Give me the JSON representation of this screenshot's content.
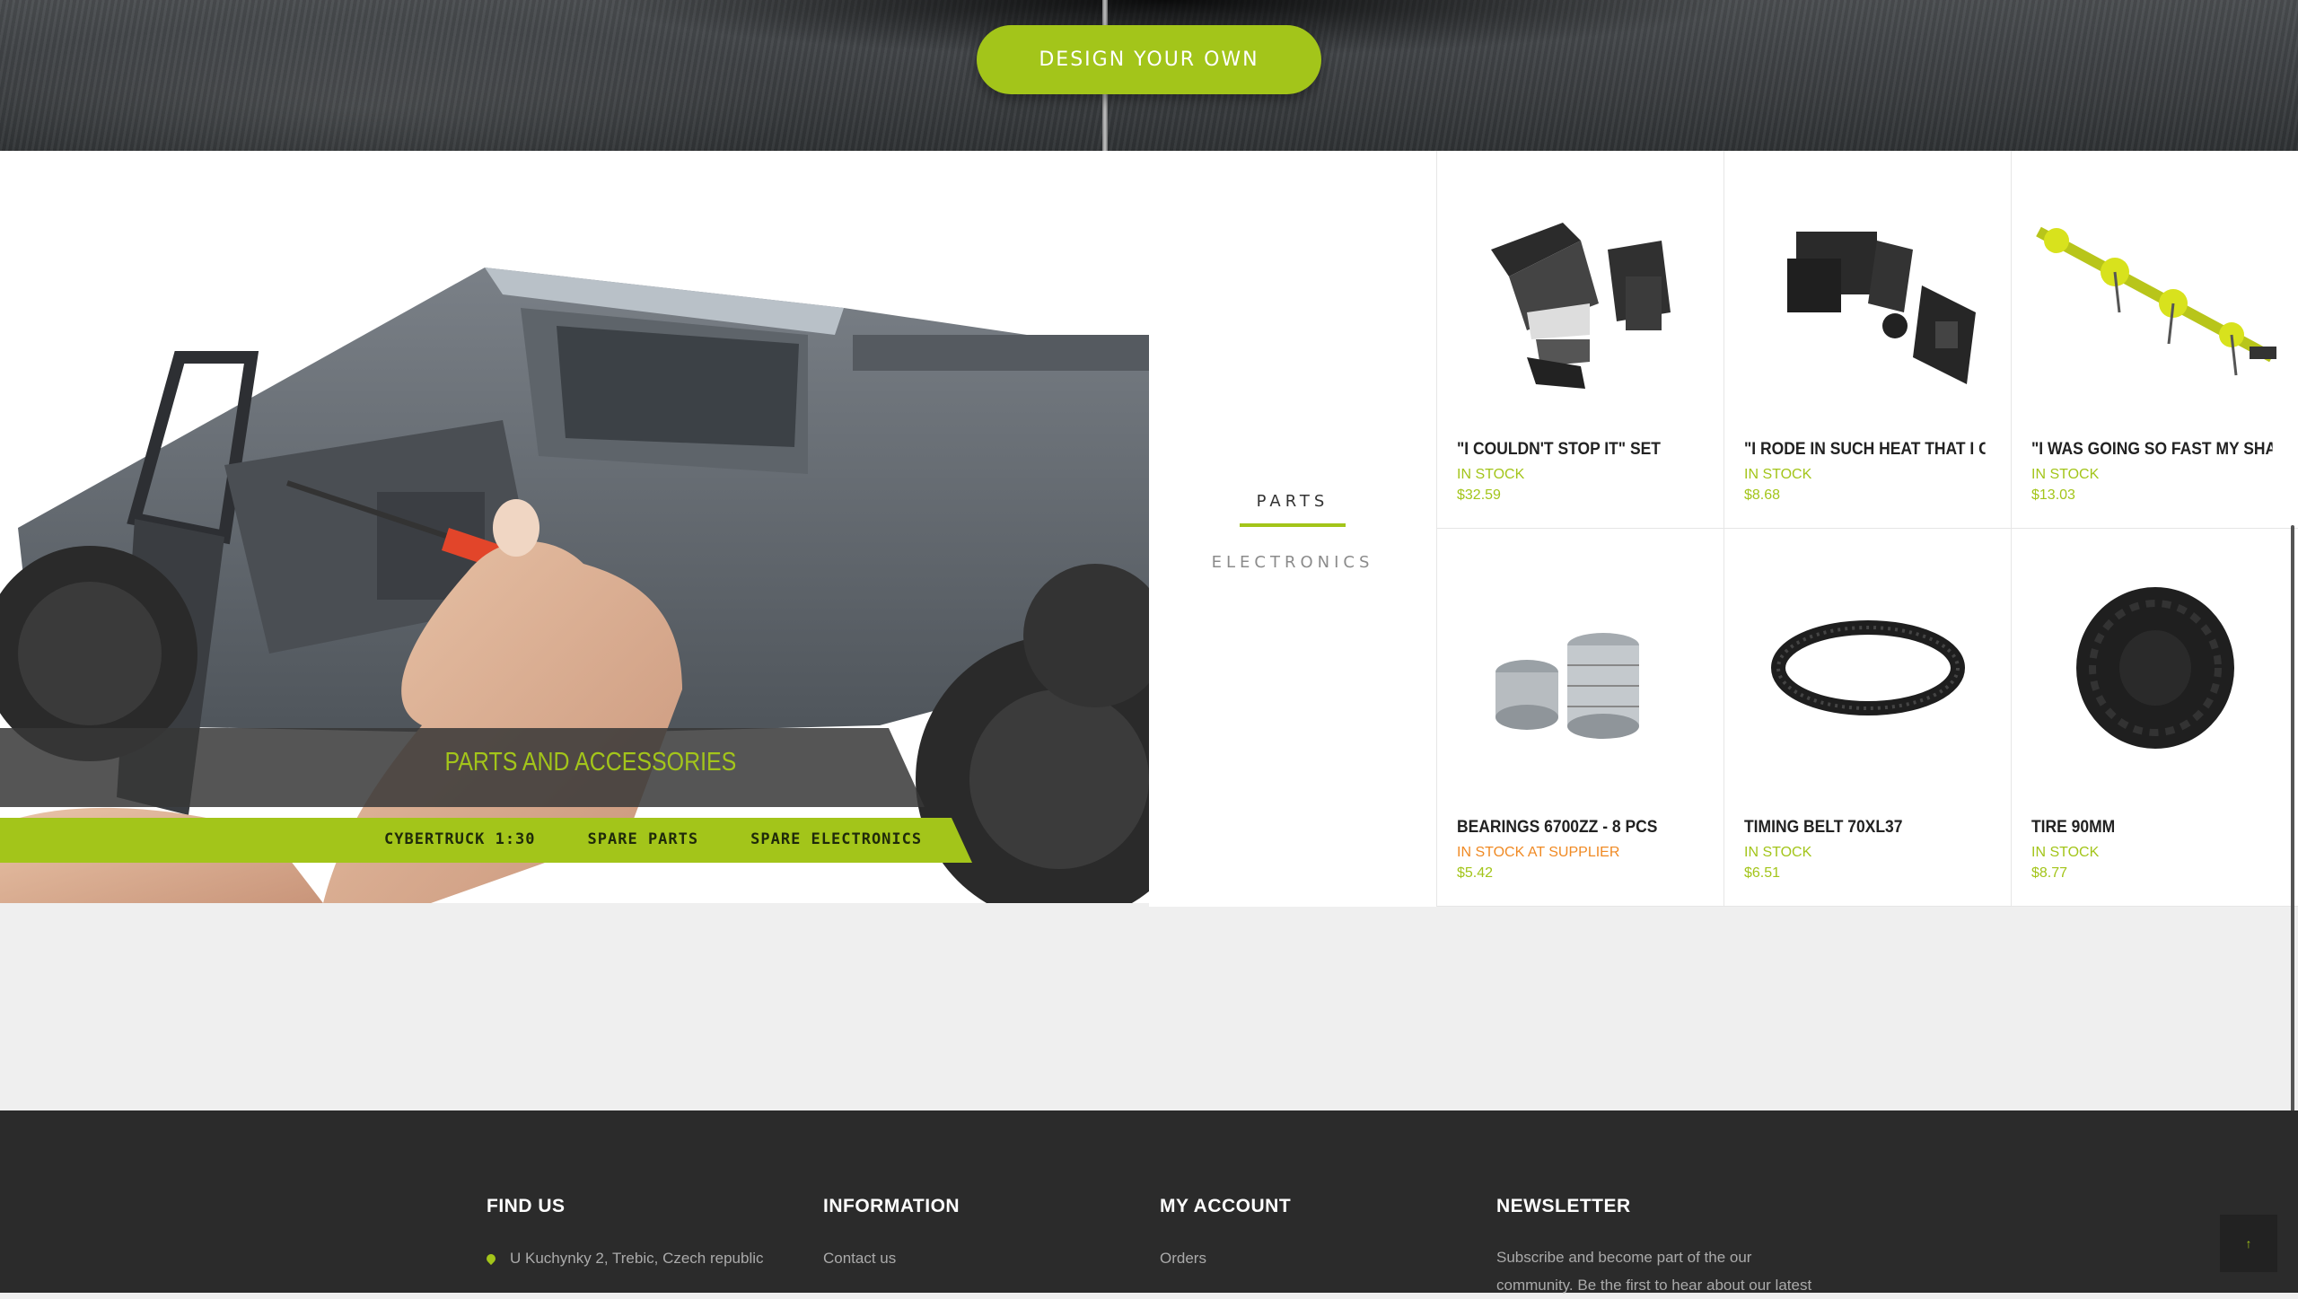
{
  "hero": {
    "button_label": "DESIGN YOUR OWN"
  },
  "promo": {
    "title": "PARTS AND ACCESSORIES",
    "links": [
      "CYBERTRUCK 1:30",
      "SPARE PARTS",
      "SPARE ELECTRONICS"
    ]
  },
  "categories": [
    {
      "label": "PARTS",
      "active": true
    },
    {
      "label": "ELECTRONICS",
      "active": false
    }
  ],
  "products": [
    {
      "name": "\"I COULDN'T STOP IT\" SET",
      "stock": "IN STOCK",
      "price": "$32.59",
      "image": "bumper-set"
    },
    {
      "name": "\"I RODE IN SUCH HEAT THAT I C...",
      "stock": "IN STOCK",
      "price": "$8.68",
      "image": "bracket-set"
    },
    {
      "name": "\"I WAS GOING SO FAST MY SHAF...",
      "stock": "IN STOCK",
      "price": "$13.03",
      "image": "yellow-shaft"
    },
    {
      "name": "BEARINGS 6700ZZ - 8 PCS",
      "stock": "IN STOCK AT SUPPLIER",
      "price": "$5.42",
      "image": "bearings"
    },
    {
      "name": "TIMING BELT 70XL37",
      "stock": "IN STOCK",
      "price": "$6.51",
      "image": "timing-belt"
    },
    {
      "name": "TIRE 90MM",
      "stock": "IN STOCK",
      "price": "$8.77",
      "image": "tire"
    }
  ],
  "footer": {
    "find_us": {
      "title": "FIND US",
      "address": "U Kuchynky 2, Trebic, Czech republic"
    },
    "information": {
      "title": "INFORMATION",
      "first_link": "Contact us"
    },
    "my_account": {
      "title": "MY ACCOUNT",
      "first_link": "Orders"
    },
    "newsletter": {
      "title": "NEWSLETTER",
      "text": "Subscribe and become part of the our community. Be the first to hear about our latest"
    }
  },
  "to_top_label": "↑",
  "colors": {
    "accent": "#a3c51a",
    "supplier_stock": "#f08a24",
    "footer_bg": "#2b2b2b"
  }
}
